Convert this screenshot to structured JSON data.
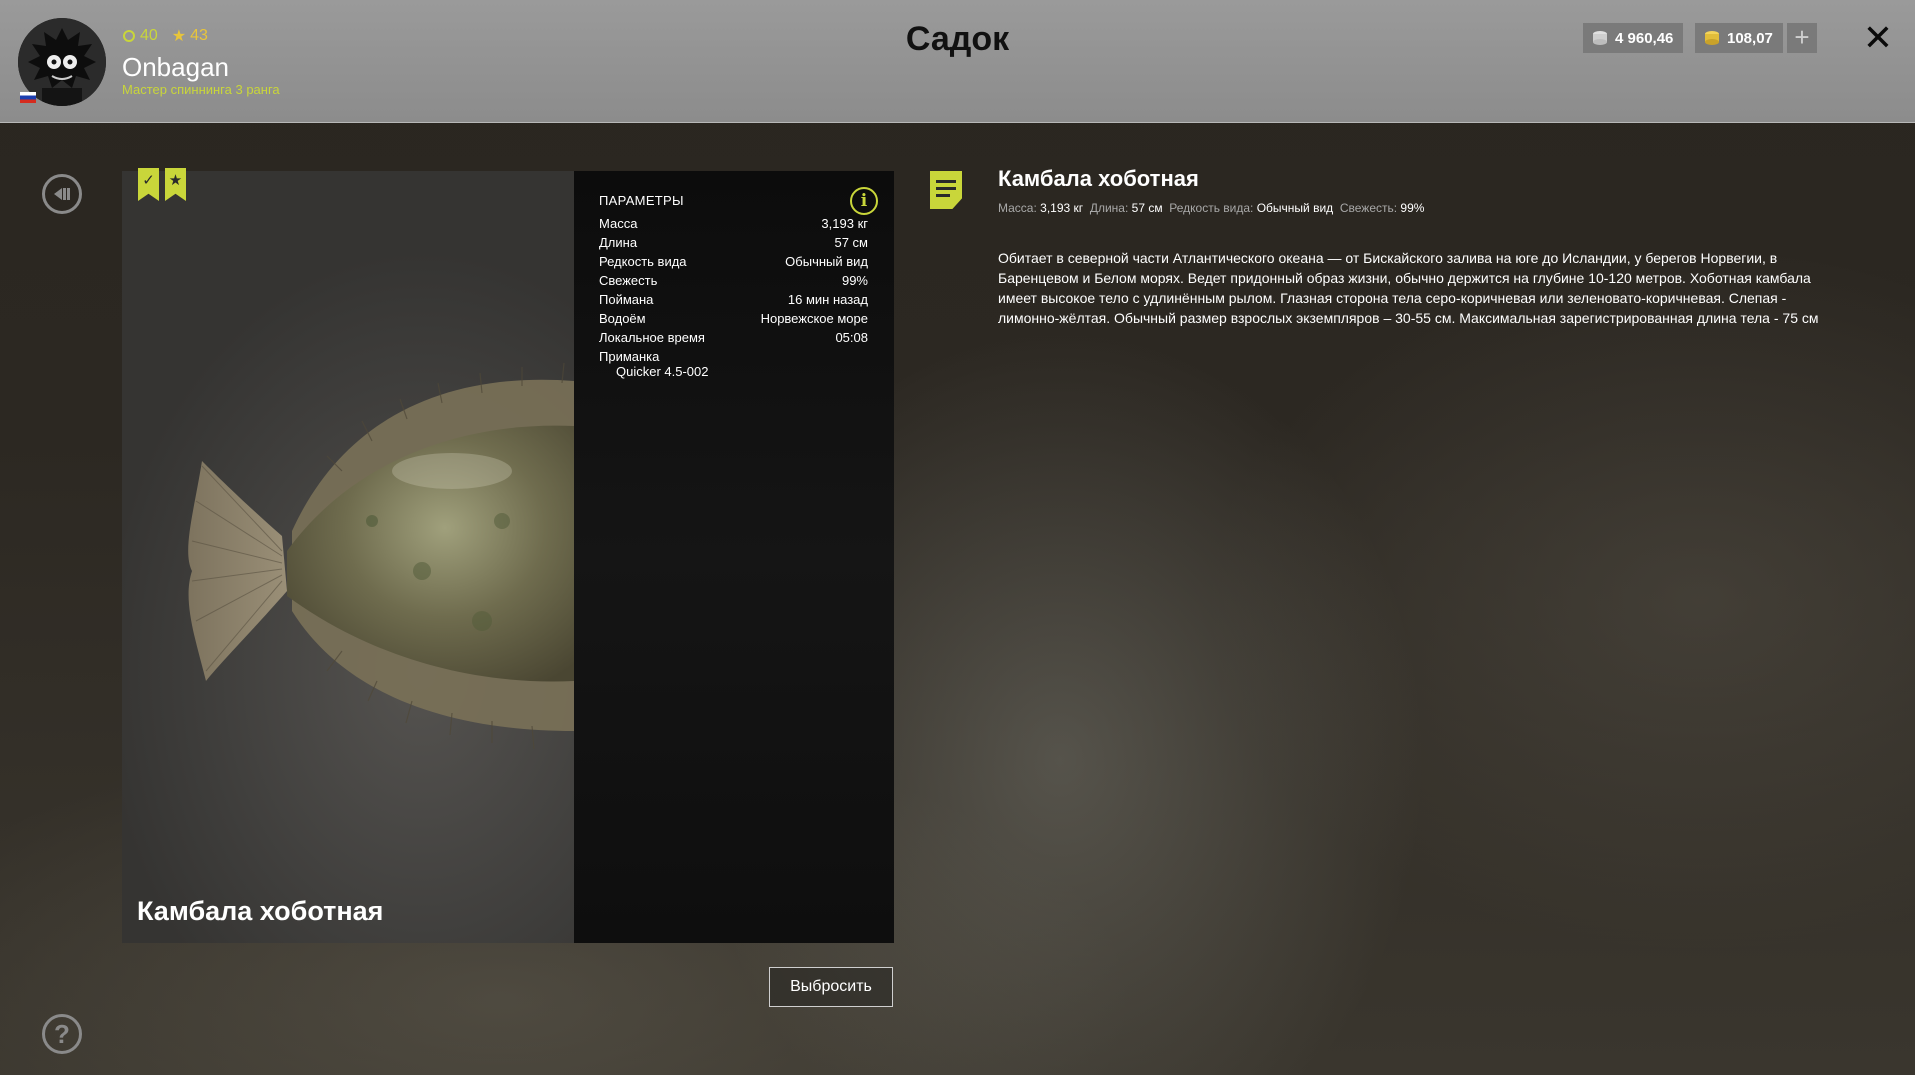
{
  "header": {
    "title": "Садок",
    "player": {
      "level": "40",
      "stars": "43",
      "name": "Onbagan",
      "rank": "Мастер спиннинга 3 ранга"
    },
    "currency": {
      "silver": "4 960,46",
      "gold": "108,07",
      "add": "+"
    },
    "close": "✕"
  },
  "fish": {
    "name": "Камбала хоботная"
  },
  "params": {
    "title": "ПАРАМЕТРЫ",
    "rows": [
      {
        "key": "Масса",
        "value": "3,193 кг"
      },
      {
        "key": "Длина",
        "value": "57 см"
      },
      {
        "key": "Редкость вида",
        "value": "Обычный вид"
      },
      {
        "key": "Свежесть",
        "value": "99%"
      },
      {
        "key": "Поймана",
        "value": "16 мин назад"
      },
      {
        "key": "Водоём",
        "value": "Норвежское море"
      },
      {
        "key": "Локальное время",
        "value": "05:08"
      }
    ],
    "bait_label": "Приманка",
    "bait_value": "Quicker 4.5-002",
    "info": "i"
  },
  "actions": {
    "discard": "Выбросить",
    "help": "?"
  },
  "description": {
    "title": "Камбала хоботная",
    "meta": {
      "mass_label": "Масса:",
      "mass": "3,193 кг",
      "length_label": "Длина:",
      "length": "57 см",
      "rarity_label": "Редкость вида:",
      "rarity": "Обычный вид",
      "fresh_label": "Свежесть:",
      "fresh": "99%"
    },
    "text": "Обитает в северной части Атлантического океана — от Бискайского залива на юге до Исландии, у берегов Норвегии, в Баренцевом и Белом морях. Ведет придонный образ жизни, обычно держится на глубине 10-120 метров. Хоботная камбала имеет высокое тело с удлинённым рылом. Глазная сторона тела серо-коричневая или зеленовато-коричневая. Слепая - лимонно-жёлтая. Обычный размер взрослых экземпляров – 30-55 см. Максимальная зарегистрированная длина тела - 75 см"
  },
  "colors": {
    "accent": "#c9d63a",
    "gold": "#e8c53a"
  },
  "icons": [
    "back-icon",
    "help-icon",
    "info-icon",
    "document-icon",
    "bookmark-check-icon",
    "bookmark-star-icon",
    "silver-coin-icon",
    "gold-coin-icon",
    "close-icon",
    "plus-icon"
  ]
}
